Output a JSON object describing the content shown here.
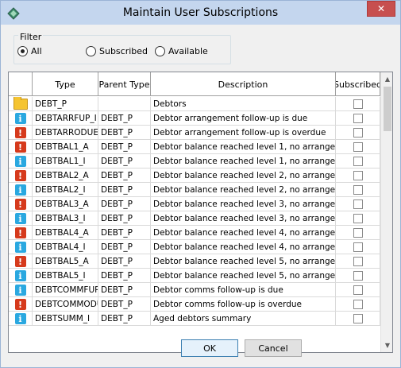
{
  "window": {
    "title": "Maintain User Subscriptions",
    "close_glyph": "✕"
  },
  "filter": {
    "legend": "Filter",
    "options": [
      {
        "label": "All",
        "checked": true
      },
      {
        "label": "Subscribed",
        "checked": false
      },
      {
        "label": "Available",
        "checked": false
      }
    ]
  },
  "grid": {
    "columns": [
      "",
      "Type",
      "Parent Type",
      "Description",
      "Subscribed"
    ],
    "rows": [
      {
        "icon": "folder-icon",
        "type": "DEBT_P",
        "parent": "",
        "desc": "Debtors",
        "subscribed": false
      },
      {
        "icon": "info-icon",
        "type": "DEBTARRFUP_I",
        "parent": "DEBT_P",
        "desc": "Debtor arrangement follow-up is due",
        "subscribed": false
      },
      {
        "icon": "alert-icon",
        "type": "DEBTARRODUE_A",
        "parent": "DEBT_P",
        "desc": "Debtor arrangement follow-up is overdue",
        "subscribed": false
      },
      {
        "icon": "alert-icon",
        "type": "DEBTBAL1_A",
        "parent": "DEBT_P",
        "desc": "Debtor balance reached level 1, no arrangement",
        "subscribed": false
      },
      {
        "icon": "info-icon",
        "type": "DEBTBAL1_I",
        "parent": "DEBT_P",
        "desc": "Debtor balance reached level 1, no arrangement",
        "subscribed": false
      },
      {
        "icon": "alert-icon",
        "type": "DEBTBAL2_A",
        "parent": "DEBT_P",
        "desc": "Debtor balance reached level 2, no arrangement",
        "subscribed": false
      },
      {
        "icon": "info-icon",
        "type": "DEBTBAL2_I",
        "parent": "DEBT_P",
        "desc": "Debtor balance reached level 2, no arrangement",
        "subscribed": false
      },
      {
        "icon": "alert-icon",
        "type": "DEBTBAL3_A",
        "parent": "DEBT_P",
        "desc": "Debtor balance reached level 3, no arrangement",
        "subscribed": false
      },
      {
        "icon": "info-icon",
        "type": "DEBTBAL3_I",
        "parent": "DEBT_P",
        "desc": "Debtor balance reached level 3, no arrangement",
        "subscribed": false
      },
      {
        "icon": "alert-icon",
        "type": "DEBTBAL4_A",
        "parent": "DEBT_P",
        "desc": "Debtor balance reached level 4, no arrangement",
        "subscribed": false
      },
      {
        "icon": "info-icon",
        "type": "DEBTBAL4_I",
        "parent": "DEBT_P",
        "desc": "Debtor balance reached level 4, no arrangement",
        "subscribed": false
      },
      {
        "icon": "alert-icon",
        "type": "DEBTBAL5_A",
        "parent": "DEBT_P",
        "desc": "Debtor balance reached level 5, no arrangement",
        "subscribed": false
      },
      {
        "icon": "info-icon",
        "type": "DEBTBAL5_I",
        "parent": "DEBT_P",
        "desc": "Debtor balance reached level 5, no arrangement",
        "subscribed": false
      },
      {
        "icon": "info-icon",
        "type": "DEBTCOMMFUP_I",
        "parent": "DEBT_P",
        "desc": "Debtor comms follow-up is due",
        "subscribed": false
      },
      {
        "icon": "alert-icon",
        "type": "DEBTCOMMODUE_A",
        "parent": "DEBT_P",
        "desc": "Debtor comms follow-up is overdue",
        "subscribed": false
      },
      {
        "icon": "info-icon",
        "type": "DEBTSUMM_I",
        "parent": "DEBT_P",
        "desc": "Aged debtors summary",
        "subscribed": false
      }
    ]
  },
  "buttons": {
    "ok": "OK",
    "cancel": "Cancel"
  }
}
